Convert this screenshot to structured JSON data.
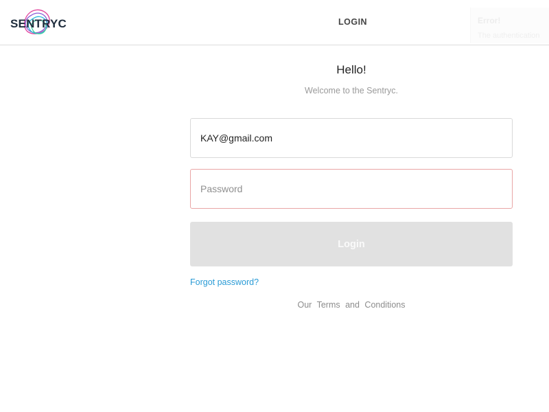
{
  "header": {
    "brand": "SENTRYC",
    "nav_login": "LOGIN"
  },
  "toast": {
    "title": "Error!",
    "message": "The authentication"
  },
  "main": {
    "greeting": "Hello!",
    "welcome": "Welcome to the Sentryc.",
    "email_value": "KAY@gmail.com",
    "password_placeholder": "Password",
    "login_button": "Login",
    "forgot_password": "Forgot password?",
    "terms": "Our Terms and Conditions"
  },
  "colors": {
    "link": "#2a9bd6",
    "error_border": "#e9a5a5",
    "button_disabled": "#e1e1e1"
  }
}
